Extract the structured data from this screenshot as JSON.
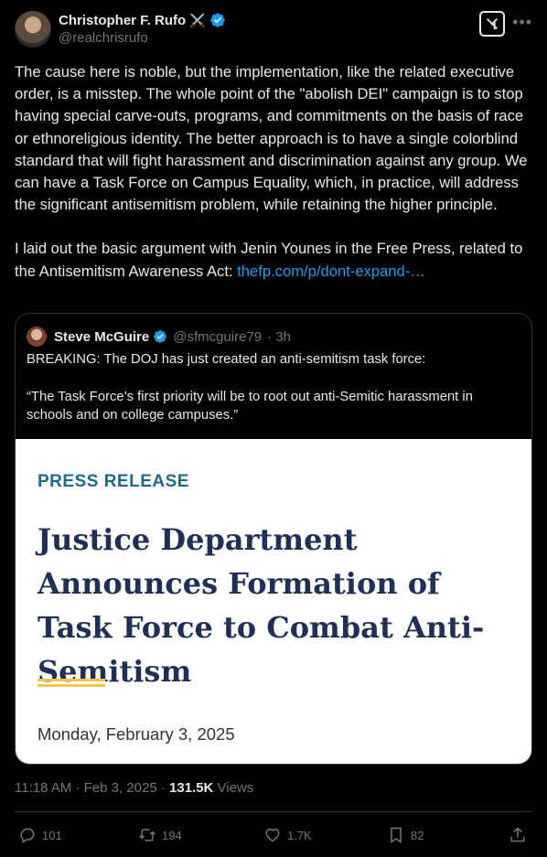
{
  "author": {
    "name": "Christopher F. Rufo",
    "emoji": "⚔️",
    "handle": "@realchrisrufo"
  },
  "post": {
    "paragraph1": "The cause here is noble, but the implementation, like the related executive order, is a misstep. The whole point of the \"abolish DEI\" campaign is to stop having special carve-outs, programs, and commitments on the basis of race or ethnoreligious identity. The better approach is to have a single colorblind standard that will fight harassment and discrimination against any group. We can have a Task Force on Campus Equality, which, in practice, will address the significant antisemitism problem, while retaining the higher principle.",
    "paragraph2": "I laid out the basic argument with Jenin Younes in the Free Press, related to the Antisemitism Awareness Act: ",
    "link": "thefp.com/p/dont-expand-…"
  },
  "quote": {
    "name": "Steve McGuire",
    "handle": "@sfmcguire79",
    "time": "· 3h",
    "line1": "BREAKING: The DOJ has just created an anti-semitism task force:",
    "line2": "“The Task Force’s first priority will be to root out anti-Semitic harassment in schools and on college campuses.”",
    "press": {
      "label": "PRESS RELEASE",
      "title": "Justice Department Announces Formation of Task Force to Combat Anti-Semitism",
      "date": "Monday, February 3, 2025"
    }
  },
  "meta": {
    "time": "11:18 AM",
    "sep": " · ",
    "date": "Feb 3, 2025",
    "views_count": "131.5K",
    "views_label": " Views"
  },
  "actions": {
    "replies": "101",
    "reposts": "194",
    "likes": "1.7K",
    "bookmarks": "82"
  },
  "colors": {
    "accent": "#1d9bf0",
    "press_label": "#1d6a86",
    "press_title": "#1f2f55",
    "press_rule": "#f3c64a"
  }
}
